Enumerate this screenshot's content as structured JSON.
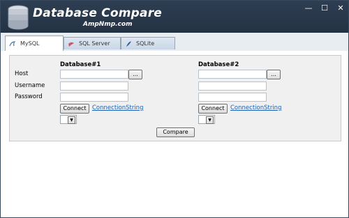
{
  "window": {
    "title": "Database Compare",
    "subtitle": "AmpNmp.com",
    "controls": {
      "minimize": "—",
      "maximize": "☐",
      "close": "✕"
    }
  },
  "tabs": [
    {
      "label": "MySQL",
      "icon": "mysql-dolphin-icon",
      "active": true
    },
    {
      "label": "SQL Server",
      "icon": "sql-server-icon",
      "active": false
    },
    {
      "label": "SQLite",
      "icon": "sqlite-feather-icon",
      "active": false
    }
  ],
  "form": {
    "labels": {
      "host": "Host",
      "username": "Username",
      "password": "Password"
    },
    "db1": {
      "heading": "Database#1",
      "host": "",
      "username": "",
      "password": "",
      "browse_label": "...",
      "connect_label": "Connect",
      "connection_string_label": "ConnectionString",
      "dropdown_value": ""
    },
    "db2": {
      "heading": "Database#2",
      "host": "",
      "username": "",
      "password": "",
      "browse_label": "...",
      "connect_label": "Connect",
      "connection_string_label": "ConnectionString",
      "dropdown_value": ""
    },
    "compare_label": "Compare"
  },
  "colors": {
    "titlebar": "#2e3e52",
    "panel": "#f0f0f0",
    "link": "#1a5fb4"
  }
}
